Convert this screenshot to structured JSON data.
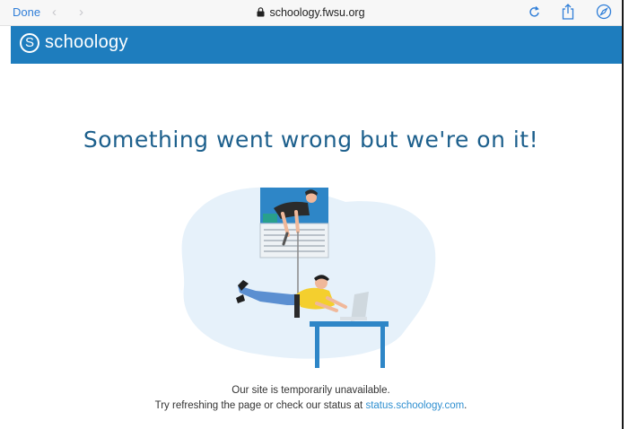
{
  "browser": {
    "done_label": "Done",
    "url": "schoology.fwsu.org",
    "icons": [
      "back-chevron-icon",
      "forward-chevron-icon",
      "lock-icon",
      "reload-icon",
      "share-icon",
      "compass-icon"
    ]
  },
  "brand": {
    "logo_letter": "S",
    "name": "schoology",
    "color": "#1e7dbe"
  },
  "error": {
    "headline": "Something went wrong but we're on it!",
    "line1": "Our site is temporarily unavailable.",
    "line2_prefix": "Try refreshing the page or check our status at ",
    "status_link": "status.schoology.com",
    "line2_suffix": "."
  },
  "colors": {
    "headline": "#1c5f8c",
    "link": "#2f8fd0"
  }
}
